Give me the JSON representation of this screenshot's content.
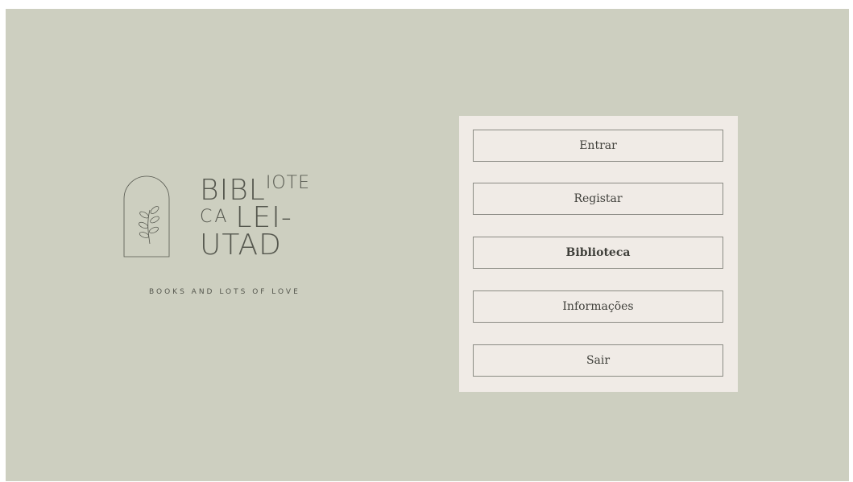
{
  "logo": {
    "line1": "BIBL",
    "line1_sup": "IOTE",
    "line2_small": "CA",
    "line2": "LEI-",
    "line3": "UTAD",
    "tagline": "BOOKS AND LOTS OF LOVE",
    "icon": "olive-branch-arch-icon"
  },
  "menu": {
    "items": [
      {
        "label": "Entrar"
      },
      {
        "label": "Registar"
      },
      {
        "label": "Biblioteca"
      },
      {
        "label": "Informações"
      },
      {
        "label": "Sair"
      }
    ]
  },
  "colors": {
    "background": "#cdcfc0",
    "panel": "#f0ebe6",
    "text": "#3f3f3a"
  }
}
